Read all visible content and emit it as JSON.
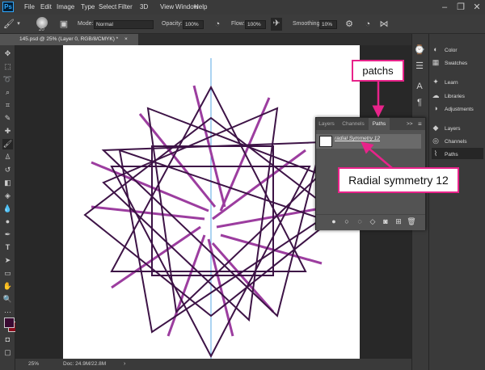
{
  "app": {
    "logo": "Ps"
  },
  "menu": [
    "File",
    "Edit",
    "Image",
    "Type",
    "Select",
    "Filter",
    "3D",
    "View",
    "Window",
    "Help"
  ],
  "window_controls": {
    "minimize": "–",
    "restore": "❐",
    "close": "✕"
  },
  "options": {
    "brush_size": "20",
    "mode_label": "Mode:",
    "mode_value": "Normal",
    "opacity_label": "Opacity:",
    "opacity_value": "100%",
    "flow_label": "Flow:",
    "flow_value": "100%",
    "smoothing_label": "Smoothing:",
    "smoothing_value": "10%"
  },
  "document": {
    "tab_title": "145.psd @ 25% (Layer 0, RGB/8/CMYK) *",
    "tab_close": "×"
  },
  "status": {
    "zoom": "25%",
    "doc_size": "Doc: 24.9M/22.8M"
  },
  "dock": {
    "items": [
      {
        "label": "Color",
        "icon": "color-wheel-icon",
        "glyph": "◐"
      },
      {
        "label": "Swatches",
        "icon": "swatches-icon",
        "glyph": "▦"
      },
      {
        "label": "Learn",
        "icon": "lightbulb-icon",
        "glyph": "✦"
      },
      {
        "label": "Libraries",
        "icon": "libraries-icon",
        "glyph": "☁"
      },
      {
        "label": "Adjustments",
        "icon": "adjustments-icon",
        "glyph": "◑"
      },
      {
        "label": "Layers",
        "icon": "layers-icon",
        "glyph": "◆"
      },
      {
        "label": "Channels",
        "icon": "channels-icon",
        "glyph": "◎"
      },
      {
        "label": "Paths",
        "icon": "paths-icon",
        "glyph": "⌇"
      }
    ]
  },
  "paths_panel": {
    "tabs": [
      "Layers",
      "Channels",
      "Paths"
    ],
    "active_tab": "Paths",
    "path_name": "radial Symmetry 12",
    "collapse_icon": ">>",
    "menu_icon": "≡"
  },
  "callouts": {
    "patchs": "patchs",
    "radial": "Radial symmetry 12"
  },
  "colors": {
    "accent_pink": "#e8238a",
    "dark_purple": "#3d1346",
    "light_purple": "#9c3d9f",
    "guide_blue": "#5aa9e6",
    "foreground_swatch": "#3a0a32",
    "background_swatch": "#8b0a1a"
  }
}
